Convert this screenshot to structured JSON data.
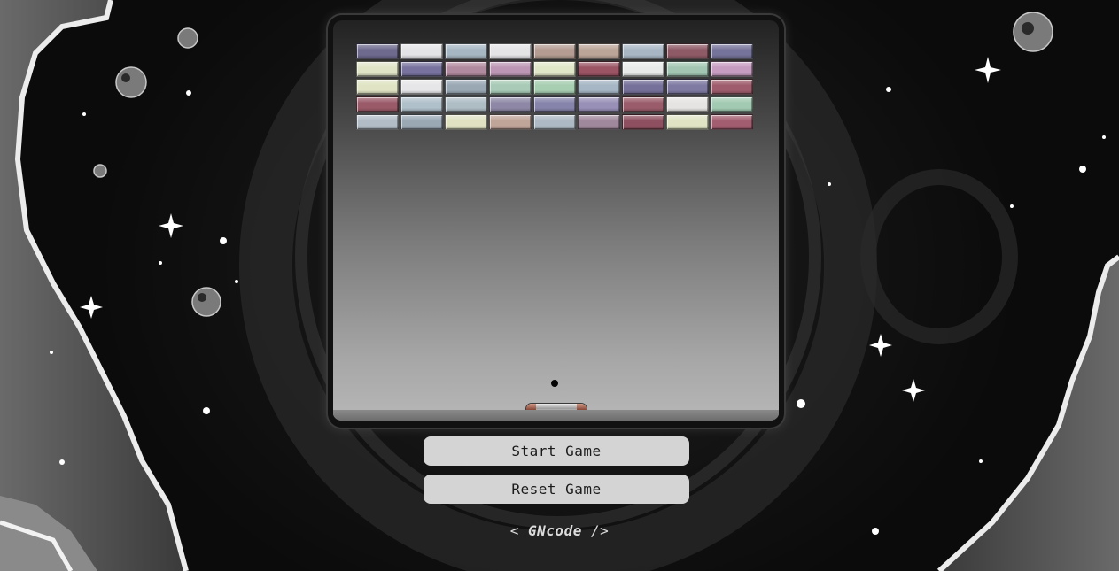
{
  "game": {
    "bricks": [
      [
        "#6e6a8e",
        "#e4e4e6",
        "#a6b6c2",
        "#e4e4e6",
        "#b49c92",
        "#bba598",
        "#a8b6c4",
        "#8e5a66",
        "#75739a"
      ],
      [
        "#dfe4c6",
        "#78739e",
        "#b08a9e",
        "#bc96b4",
        "#e0e6c8",
        "#9a5464",
        "#e8eaea",
        "#a2c6b2",
        "#c69cc0"
      ],
      [
        "#e0e4c4",
        "#e6e6e8",
        "#9aa8b4",
        "#a8cab6",
        "#a8ceb2",
        "#a6b6c4",
        "#76719a",
        "#7e7aa2",
        "#9e5c6c"
      ],
      [
        "#9a5a68",
        "#b0c0ca",
        "#aebcc4",
        "#8e88a6",
        "#8684aa",
        "#9890b6",
        "#9a5c6a",
        "#e6e4e2",
        "#a2cab2"
      ],
      [
        "#b2bcc6",
        "#9aa8b4",
        "#e0e2c2",
        "#bfa498",
        "#adb9c4",
        "#a0889c",
        "#8e5060",
        "#e0e4c4",
        "#a25e70"
      ]
    ],
    "paddle_cap_color": "#8a4a3a",
    "ball_color": "#050505"
  },
  "controls": {
    "start_label": "Start Game",
    "reset_label": "Reset Game"
  },
  "footer": {
    "open": "< ",
    "brand": "GNcode",
    "close": " />"
  }
}
